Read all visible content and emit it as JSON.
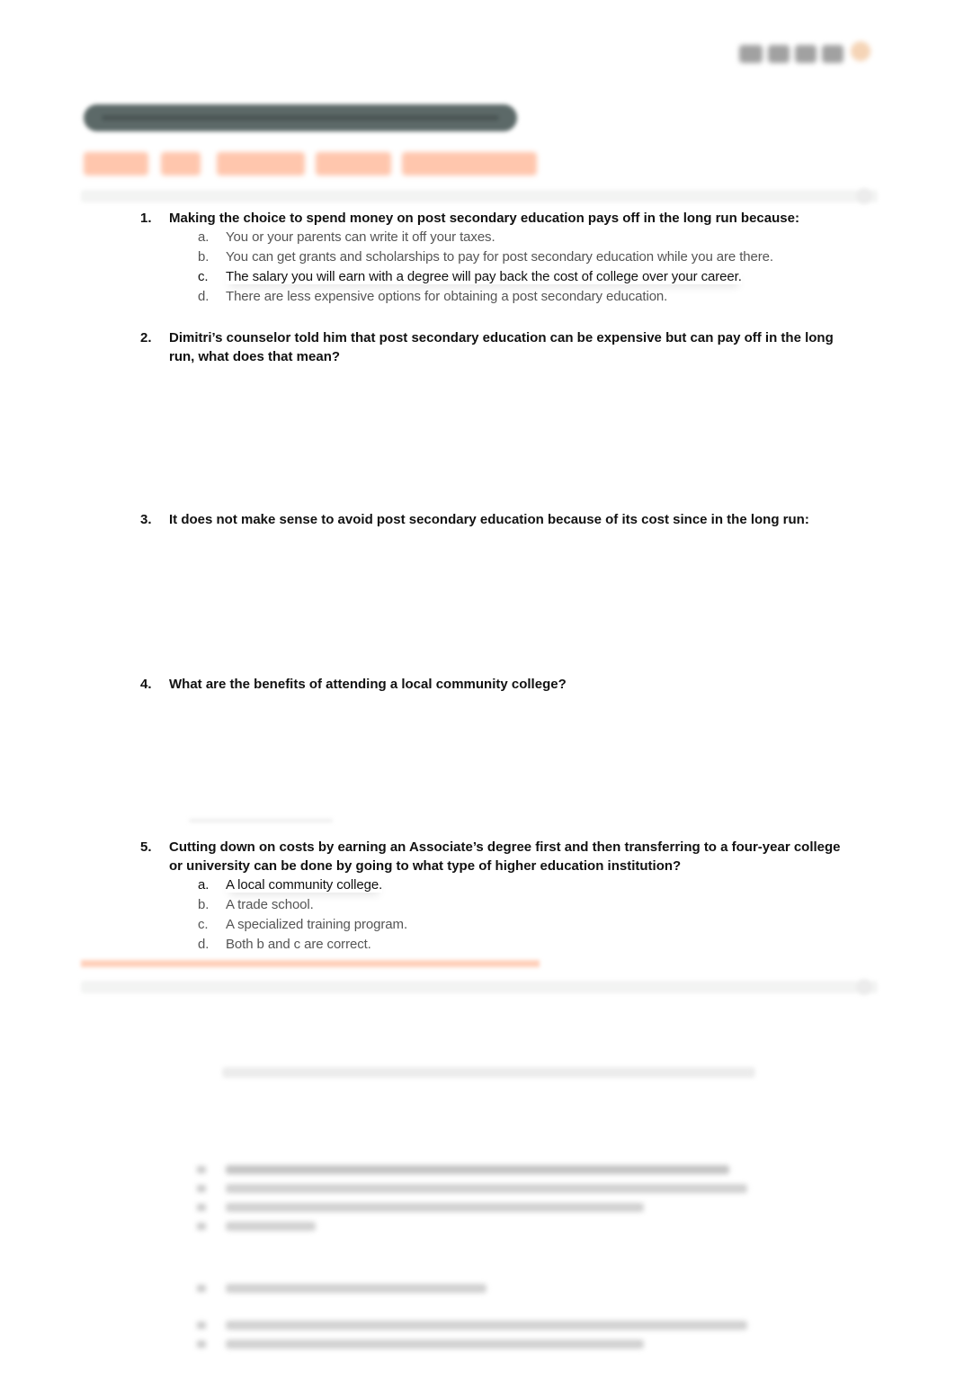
{
  "header": {
    "logo": "brand-logo",
    "category_pill": "",
    "lesson_title": "",
    "colors": {
      "pill": "#5c6968",
      "title": "#f7a27f",
      "rule": "#f3f4f3"
    }
  },
  "questions": [
    {
      "number": "1.",
      "text": "Making the choice to spend money on post secondary education pays off in the long run because:",
      "options": [
        {
          "letter": "a.",
          "text": "You or your parents can write it off your taxes.",
          "correct": false
        },
        {
          "letter": "b.",
          "text": "You can get grants and scholarships to pay for post secondary education while you are there.",
          "correct": false
        },
        {
          "letter": "c.",
          "text": "The salary you will earn with a degree will pay back the cost of college over your career.",
          "correct": true
        },
        {
          "letter": "d.",
          "text": "There are less expensive options for obtaining a post secondary education.",
          "correct": false
        }
      ]
    },
    {
      "number": "2.",
      "text": "Dimitri’s counselor told him that post secondary education can be expensive but can pay off in the long run, what does that mean?",
      "options": []
    },
    {
      "number": "3.",
      "text": "It does not make sense to avoid post secondary education because of its cost since in the long run:",
      "options": []
    },
    {
      "number": "4.",
      "text": "What are the benefits of attending a local community college?",
      "options": []
    },
    {
      "number": "5.",
      "text": "Cutting down on costs by earning an Associate’s degree first and then transferring to a four-year college or university can be done by going to what type of higher education institution?",
      "options": [
        {
          "letter": "a.",
          "text": "A local community college.",
          "correct": true
        },
        {
          "letter": "b.",
          "text": "A trade school.",
          "correct": false
        },
        {
          "letter": "c.",
          "text": "A specialized training program.",
          "correct": false
        },
        {
          "letter": "d.",
          "text": "Both b and c are correct.",
          "correct": false
        }
      ]
    }
  ],
  "obscured_preview": {
    "note": "blurred content, unreadable"
  }
}
